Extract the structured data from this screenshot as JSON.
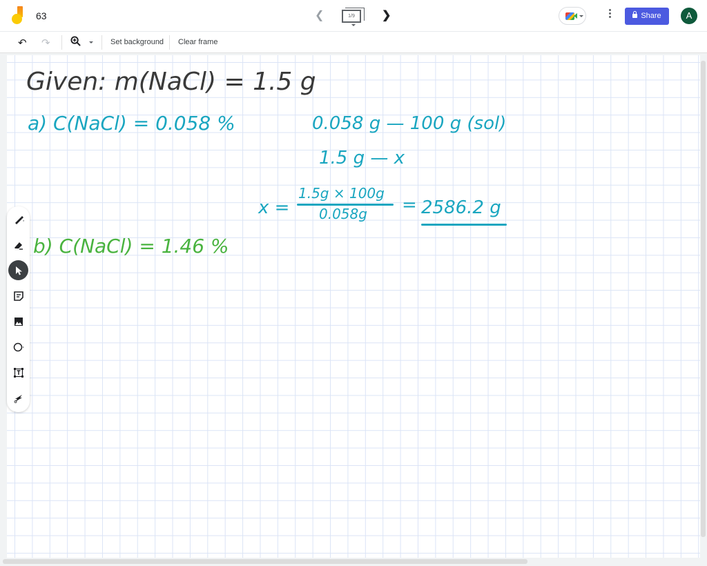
{
  "header": {
    "app_icon": "jamboard-logo-icon",
    "title": "63",
    "frame_indicator": "1/9",
    "prev_icon": "chevron-left-icon",
    "next_icon": "chevron-right-icon",
    "meet_icon": "google-meet-icon",
    "more_icon": "more-vert-icon",
    "share_label": "Share",
    "share_icon": "lock-icon",
    "avatar_initial": "A"
  },
  "toolbar": {
    "undo_icon": "undo-icon",
    "redo_icon": "redo-icon",
    "zoom_icon": "zoom-in-icon",
    "set_background_label": "Set background",
    "clear_frame_label": "Clear frame"
  },
  "tools": [
    {
      "name": "pen",
      "icon": "pen-icon",
      "active": false
    },
    {
      "name": "eraser",
      "icon": "eraser-icon",
      "active": false
    },
    {
      "name": "select",
      "icon": "select-arrow-icon",
      "active": true
    },
    {
      "name": "sticky-note",
      "icon": "sticky-note-icon",
      "active": false
    },
    {
      "name": "image",
      "icon": "image-icon",
      "active": false
    },
    {
      "name": "circle",
      "icon": "circle-shape-icon",
      "active": false
    },
    {
      "name": "text-box",
      "icon": "text-box-icon",
      "active": false
    },
    {
      "name": "laser",
      "icon": "laser-icon",
      "active": false
    }
  ],
  "canvas": {
    "colors": {
      "black": "#3a3a3a",
      "teal": "#1aa6c0",
      "green": "#49b33f"
    },
    "handwriting": {
      "given": "Given: m(NaCl) = 1.5 g",
      "part_a": "a) C(NaCl) = 0.058 %",
      "proportion_1": "0.058 g  —  100 g  (sol)",
      "proportion_2": "1.5 g  —  x",
      "x_eq": "x =",
      "numerator": "1.5g × 100g",
      "denominator": "0.058g",
      "equals": "=",
      "result": "2586.2 g",
      "part_b": "b) C(NaCl) = 1.46 %"
    }
  }
}
